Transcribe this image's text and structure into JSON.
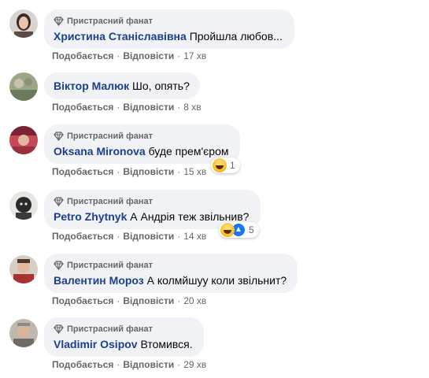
{
  "comments": [
    {
      "badge": "Пристрасний фанат",
      "author": "Христина Станіславівна",
      "text": "Пройшла любов...",
      "like": "Подобається",
      "reply": "Відповісти",
      "time": "17 хв",
      "avatar_color": "#5b4b45"
    },
    {
      "badge": "",
      "author": "Віктор Малюк",
      "text": "Шо, опять?",
      "like": "Подобається",
      "reply": "Відповісти",
      "time": "8 хв",
      "avatar_color": "#7c8a6e"
    },
    {
      "badge": "Пристрасний фанат",
      "author": "Oksana Mironova",
      "text": "буде прем'єром",
      "like": "Подобається",
      "reply": "Відповісти",
      "time": "15 хв",
      "reaction_count": "1",
      "avatar_color": "#b03a48"
    },
    {
      "badge": "Пристрасний фанат",
      "author": "Petro Zhytnyk",
      "text": "А Андрія теж звільнив?",
      "like": "Подобається",
      "reply": "Відповісти",
      "time": "14 хв",
      "reaction_count": "5",
      "avatar_color": "#3a3a3a"
    },
    {
      "badge": "Пристрасний фанат",
      "author": "Валентин Мороз",
      "text": "А колмйшуу коли звільнит?",
      "like": "Подобається",
      "reply": "Відповісти",
      "time": "20 хв",
      "avatar_color": "#a83232"
    },
    {
      "badge": "Пристрасний фанат",
      "author": "Vladimir Osipov",
      "text": "Втомився.",
      "like": "Подобається",
      "reply": "Відповісти",
      "time": "29 хв",
      "avatar_color": "#6f6a62"
    }
  ],
  "colors": {
    "bubble": "#f0f2f5",
    "author": "#1c3f8f",
    "meta": "#65676b",
    "like_reaction": "#1877f2",
    "haha_reaction": "#f7b928"
  },
  "icons": {
    "badge": "diamond-icon",
    "reaction_haha": "haha-reaction-icon",
    "reaction_like": "like-reaction-icon"
  }
}
